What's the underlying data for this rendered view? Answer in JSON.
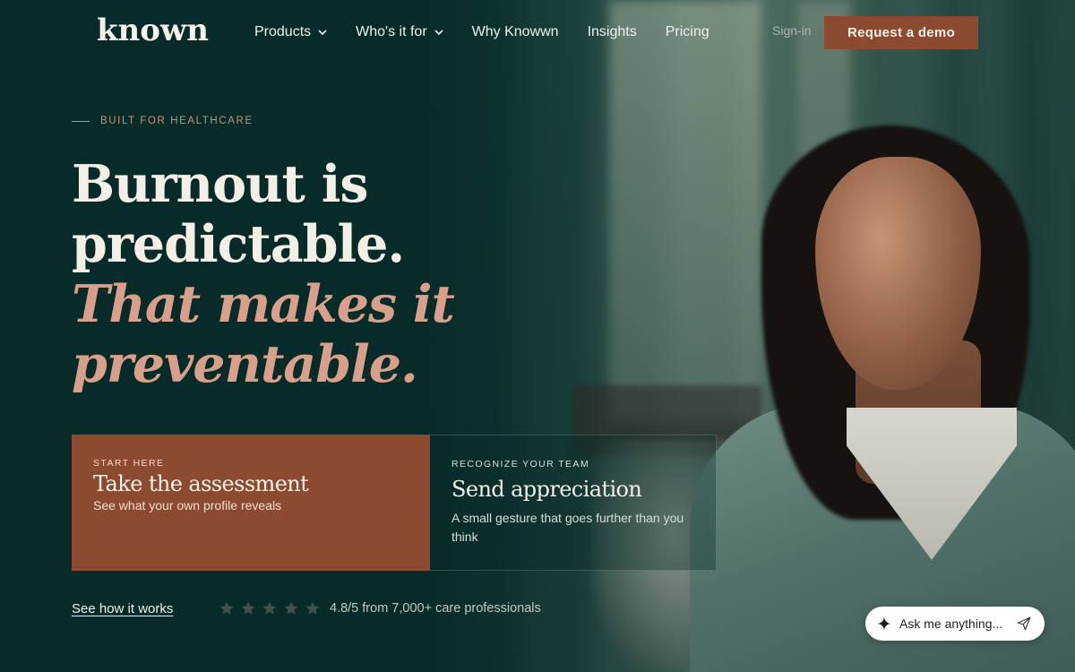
{
  "brand": {
    "logo_text": "known"
  },
  "nav": {
    "items": [
      {
        "label": "Products",
        "has_dropdown": true
      },
      {
        "label": "Who's it for",
        "has_dropdown": true
      },
      {
        "label": "Why Knowwn",
        "has_dropdown": false
      },
      {
        "label": "Insights",
        "has_dropdown": false
      },
      {
        "label": "Pricing",
        "has_dropdown": false
      }
    ],
    "sign_in": "Sign-in",
    "cta": "Request a demo"
  },
  "hero": {
    "eyebrow": "BUILT FOR HEALTHCARE",
    "headline_line1": "Burnout is",
    "headline_line2": "predictable.",
    "headline_accent1": "That makes it",
    "headline_accent2": "preventable."
  },
  "cards": {
    "assessment": {
      "kicker": "START HERE",
      "title": "Take the assessment",
      "subtitle": "See what your own profile reveals"
    },
    "appreciation": {
      "kicker": "RECOGNIZE YOUR TEAM",
      "title": "Send appreciation",
      "subtitle": "A small gesture that goes further than you think"
    }
  },
  "bottom": {
    "see_how": "See how it works",
    "rating": {
      "stars": 5,
      "text": "4.8/5 from 7,000+ care professionals"
    }
  },
  "ask_widget": {
    "placeholder": "Ask me anything...",
    "icons": [
      "sparkle-icon",
      "send-icon"
    ]
  },
  "colors": {
    "background": "#072b28",
    "accent": "#8c4a31",
    "headline_accent": "#d8a08a",
    "eyebrow": "#c8917a"
  }
}
